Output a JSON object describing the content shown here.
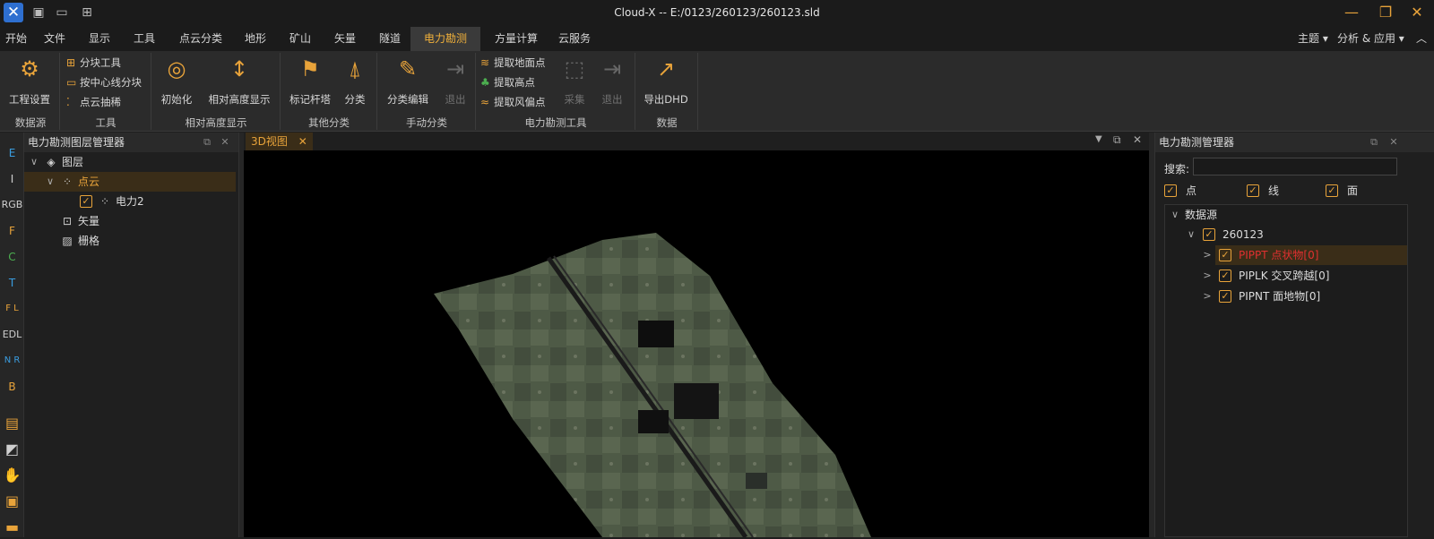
{
  "window": {
    "title": "Cloud-X -- E:/0123/260123/260123.sld",
    "logo_glyph": "✕",
    "controls": {
      "minimize": "—",
      "restore": "❐",
      "close": "✕"
    }
  },
  "menu": {
    "items": [
      "开始",
      "文件",
      "显示",
      "工具",
      "点云分类",
      "地形",
      "矿山",
      "矢量",
      "隧道",
      "电力勘测",
      "方量计算",
      "云服务"
    ],
    "active": "电力勘测",
    "right": {
      "theme": "主题 ▾",
      "analysis": "分析 & 应用 ▾",
      "collapse": "︿"
    }
  },
  "ribbon": {
    "project_settings": "工程设置",
    "block_tool": "分块工具",
    "centerline_block": "按中心线分块",
    "thin_cloud": "点云抽稀",
    "init": "初始化",
    "relative_height": "相对高度显示",
    "mark_tower": "标记杆塔",
    "classify": "分类",
    "classify_edit": "分类编辑",
    "exit": "退出",
    "extract_ground": "提取地面点",
    "extract_high": "提取高点",
    "extract_wind": "提取风偏点",
    "collect": "采集",
    "exit2": "退出",
    "export_dhd": "导出DHD",
    "groups": [
      "数据源",
      "工具",
      "相对高度显示",
      "其他分类",
      "手动分类",
      "电力勘测工具",
      "数据"
    ]
  },
  "left_toolbar": [
    "E",
    "I",
    "RGB",
    "F",
    "C",
    "T",
    "F L",
    "EDL",
    "N R",
    "B"
  ],
  "layer_panel": {
    "title": "电力勘测图层管理器",
    "root": "图层",
    "point_cloud": "点云",
    "power2": "电力2",
    "vector": "矢量",
    "raster": "栅格"
  },
  "view": {
    "tab": "3D视图"
  },
  "right_panel": {
    "title": "电力勘测管理器",
    "search_label": "搜索:",
    "search_value": "",
    "filters": [
      "点",
      "线",
      "面"
    ],
    "datasource": "数据源",
    "dataset": "260123",
    "children": [
      "PIPPT 点状物[0]",
      "PIPLK 交叉跨越[0]",
      "PIPNT 面地物[0]"
    ]
  },
  "colors": {
    "accent": "#e8a33a",
    "selected_text": "#e03030",
    "terrain": "#4e5a46"
  }
}
